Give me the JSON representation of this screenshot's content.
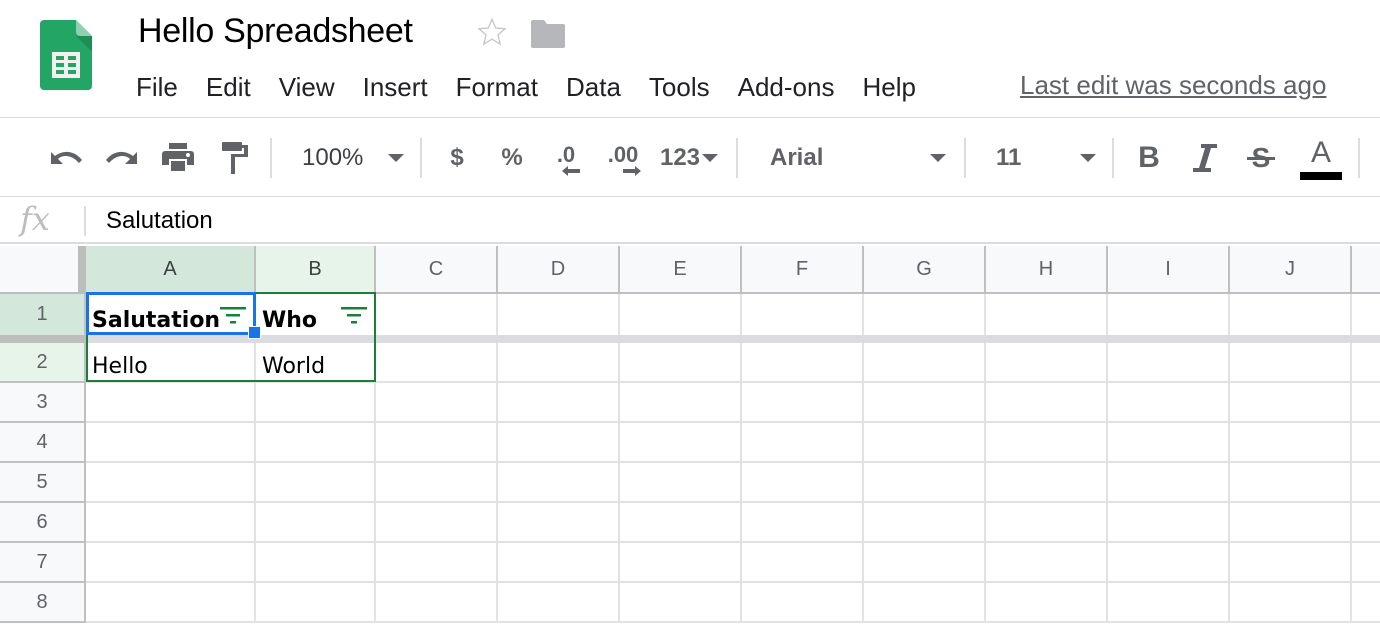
{
  "app": {
    "doc_title": "Hello Spreadsheet",
    "icons": {
      "logo": "google-sheets-logo",
      "star": "star-outline-icon",
      "folder": "folder-icon"
    },
    "menu": [
      "File",
      "Edit",
      "View",
      "Insert",
      "Format",
      "Data",
      "Tools",
      "Add-ons",
      "Help"
    ],
    "last_edit": "Last edit was seconds ago"
  },
  "toolbar": {
    "zoom": "100%",
    "currency": "$",
    "percent": "%",
    "decrease_decimal": ".0",
    "increase_decimal": ".00",
    "more_formats": "123",
    "font": "Arial",
    "font_size": "11",
    "bold": "B",
    "italic": "I",
    "strikethrough": "S",
    "text_color": "A",
    "text_color_value": "#000000"
  },
  "formula_bar": {
    "fx": "fx",
    "value": "Salutation"
  },
  "grid": {
    "columns": [
      "A",
      "B",
      "C",
      "D",
      "E",
      "F",
      "G",
      "H",
      "I",
      "J"
    ],
    "rows": [
      "1",
      "2",
      "3",
      "4",
      "5",
      "6",
      "7",
      "8"
    ],
    "active_cell": "A1",
    "selected_range": "A1:B2",
    "frozen_rows": 1,
    "cells": {
      "A1": "Salutation",
      "B1": "Who",
      "A2": "Hello",
      "B2": "World"
    },
    "filter_columns": [
      "A",
      "B"
    ]
  },
  "colors": {
    "brand_green": "#0f9d58",
    "selection_blue": "#1a73e8",
    "range_green": "#188038",
    "header_selected": "#d3e8da"
  }
}
